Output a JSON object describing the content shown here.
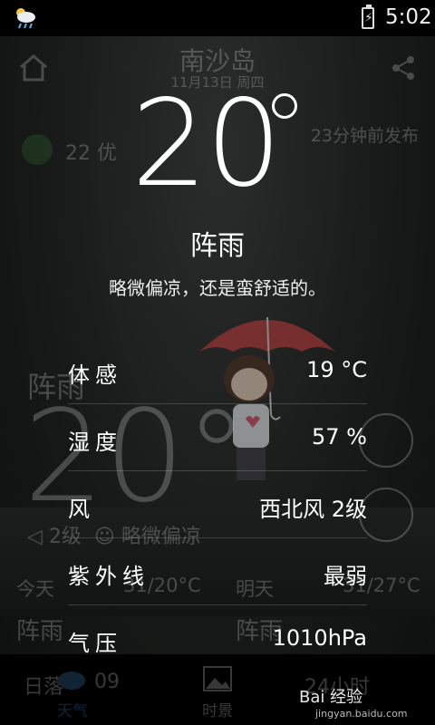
{
  "status_bar": {
    "time": "5:02",
    "weather_icon": "cloud-rain-icon",
    "battery_icon": "battery-charging-icon"
  },
  "background_app": {
    "city": "南沙岛",
    "date": "11月13日 周四",
    "aqi_value": "22 优",
    "published": "23分钟前发布",
    "condition": "阵雨",
    "temperature": "20°",
    "wind": "2级",
    "comfort": "略微偏凉",
    "today_label": "今天",
    "today_temp": "31/20°C",
    "today_cond": "阵雨",
    "tomorrow_label": "明天",
    "tomorrow_temp": "31/27°C",
    "tomorrow_cond": "阵雨",
    "nav": {
      "weather": "天气",
      "scenery": "时景",
      "sunrise_label": "日落",
      "sunrise_time": "09",
      "sunset_time": "24小时"
    }
  },
  "detail": {
    "temperature": "20",
    "condition": "阵雨",
    "description": "略微偏凉，还是蛮舒适的。",
    "rows": [
      {
        "label": "体感",
        "value": "19 °C"
      },
      {
        "label": "湿度",
        "value": "57 %"
      },
      {
        "label": "风",
        "value": "西北风 2级"
      },
      {
        "label": "紫外线",
        "value": "最弱"
      },
      {
        "label": "气压",
        "value": "1010hPa"
      }
    ]
  },
  "watermark": {
    "text": "Bai 经验",
    "url_text": "jingyan.baidu.com"
  },
  "colors": {
    "leaf_green": "#3d8a3a",
    "umbrella_red": "#c0393b"
  }
}
